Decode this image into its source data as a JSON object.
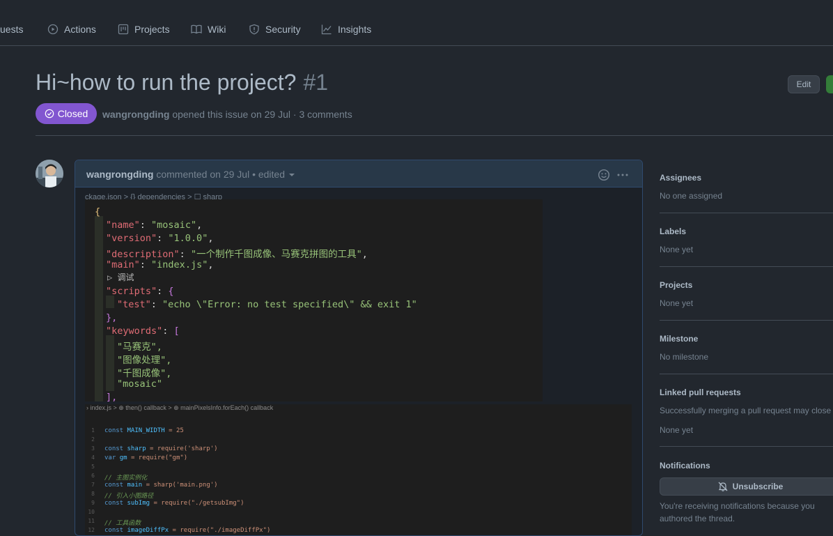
{
  "nav": {
    "pull_requests": "uests",
    "actions": "Actions",
    "projects": "Projects",
    "wiki": "Wiki",
    "security": "Security",
    "insights": "Insights"
  },
  "issue": {
    "title": "Hi~how to run the project?",
    "number": "#1",
    "edit_label": "Edit",
    "state": "Closed",
    "author": "wangrongding",
    "meta": "opened this issue on 29 Jul · 3 comments"
  },
  "comment": {
    "author": "wangrongding",
    "meta": "commented on 29 Jul • edited",
    "screenshot1": {
      "breadcrumb": "ckage.json > {} dependencies > ☐ sharp",
      "debug_label": "▷ 调试",
      "lines": [
        {
          "t": "{",
          "c": "#e5c07b"
        },
        {
          "key": "\"name\"",
          "val": "\"mosaic\"",
          "tail": ","
        },
        {
          "key": "\"version\"",
          "val": "\"1.0.0\"",
          "tail": ","
        },
        {
          "key": "\"description\"",
          "val": "\"一个制作千图成像、马赛克拼图的工具\"",
          "tail": ","
        },
        {
          "key": "\"main\"",
          "val": "\"index.js\"",
          "tail": ","
        },
        {
          "key": "\"scripts\"",
          "val": "{",
          "tail": ""
        },
        {
          "key": "\"test\"",
          "val": "\"echo \\\"Error: no test specified\\\" && exit 1\"",
          "tail": ""
        },
        {
          "t": "},",
          "c": "#c678dd"
        },
        {
          "key": "\"keywords\"",
          "val": "[",
          "tail": ""
        },
        {
          "t": "\"马赛克\",",
          "c": "#98c379"
        },
        {
          "t": "\"图像处理\",",
          "c": "#98c379"
        },
        {
          "t": "\"千图成像\",",
          "c": "#98c379"
        },
        {
          "t": "\"mosaic\"",
          "c": "#98c379"
        },
        {
          "t": "],",
          "c": "#c678dd"
        }
      ]
    },
    "screenshot2": {
      "breadcrumb": "› index.js > ⊕ then() callback > ⊕ mainPixelsInfo.forEach() callback",
      "lines": [
        {
          "n": "1",
          "t": "const MAIN_WIDTH = 25"
        },
        {
          "n": "2",
          "t": ""
        },
        {
          "n": "3",
          "t": "const sharp = require('sharp')"
        },
        {
          "n": "4",
          "t": "var gm = require(\"gm\")"
        },
        {
          "n": "5",
          "t": ""
        },
        {
          "n": "6",
          "t": "// 主图实例化"
        },
        {
          "n": "7",
          "t": "const main = sharp('main.png')"
        },
        {
          "n": "8",
          "t": "// 引入小图路径"
        },
        {
          "n": "9",
          "t": "const subImg = require(\"./getsubImg\")"
        },
        {
          "n": "10",
          "t": ""
        },
        {
          "n": "11",
          "t": "// 工具函数"
        },
        {
          "n": "12",
          "t": "const imageDiffPx = require(\"./imageDiffPx\")"
        }
      ]
    }
  },
  "sidebar": {
    "assignees": {
      "title": "Assignees",
      "value": "No one assigned"
    },
    "labels": {
      "title": "Labels",
      "value": "None yet"
    },
    "projects": {
      "title": "Projects",
      "value": "None yet"
    },
    "milestone": {
      "title": "Milestone",
      "value": "No milestone"
    },
    "linked_prs": {
      "title": "Linked pull requests",
      "desc": "Successfully merging a pull request may close this issue.",
      "value": "None yet"
    },
    "notifications": {
      "title": "Notifications",
      "button": "Unsubscribe",
      "desc": "You're receiving notifications because you authored the thread."
    }
  }
}
